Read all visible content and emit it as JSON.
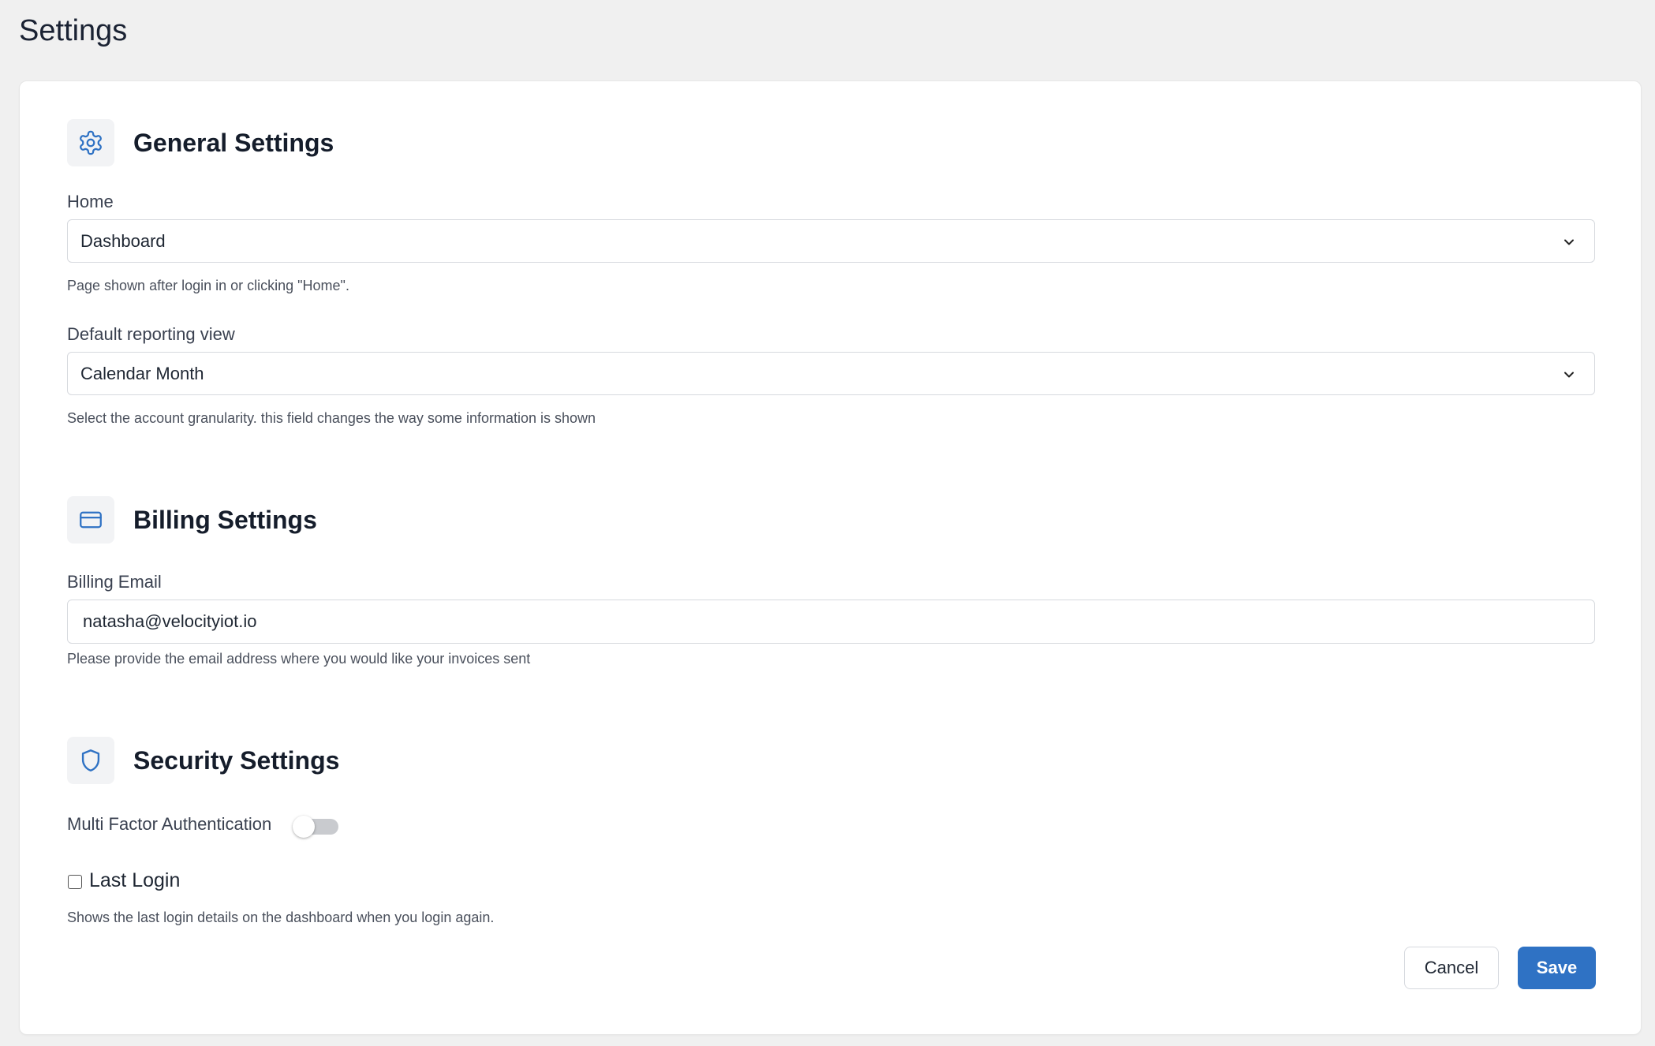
{
  "page": {
    "title": "Settings"
  },
  "general": {
    "title": "General Settings",
    "icon": "gear-icon",
    "home": {
      "label": "Home",
      "value": "Dashboard",
      "help": "Page shown after login in or clicking \"Home\"."
    },
    "reporting": {
      "label": "Default reporting view",
      "value": "Calendar Month",
      "help": "Select the account granularity. this field changes the way some information is shown"
    }
  },
  "billing": {
    "title": "Billing Settings",
    "icon": "credit-card-icon",
    "email": {
      "label": "Billing Email",
      "value": "natasha@velocityiot.io",
      "help": "Please provide the email address where you would like your invoices sent"
    }
  },
  "security": {
    "title": "Security Settings",
    "icon": "shield-icon",
    "mfa": {
      "label": "Multi Factor Authentication",
      "enabled": false
    },
    "last_login": {
      "label": "Last Login",
      "checked": false,
      "help": "Shows the last login details on the dashboard when you login again."
    }
  },
  "actions": {
    "cancel_label": "Cancel",
    "save_label": "Save"
  },
  "colors": {
    "accent": "#2f72c4",
    "icon": "#2f72c4",
    "background": "#f0f0f0"
  }
}
